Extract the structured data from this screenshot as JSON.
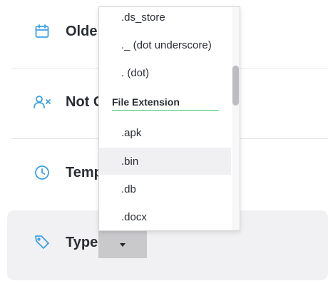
{
  "rows": [
    {
      "label": "Olde",
      "icon": "calendar-icon"
    },
    {
      "label": "Not C",
      "icon": "user-x-icon"
    },
    {
      "label": "Temp",
      "icon": "clock-icon"
    },
    {
      "label": "Type",
      "icon": "tag-icon"
    }
  ],
  "dropdown": {
    "items_before": [
      ".ds_store",
      "._ (dot underscore)",
      ". (dot)"
    ],
    "group_label": "File Extension",
    "items_after": [
      ".apk",
      ".bin",
      ".db",
      ".docx"
    ],
    "hovered_item": ".bin"
  },
  "colors": {
    "icon_blue": "#3aa0e6",
    "group_underline": "#3cc36b",
    "trigger_bg": "#c9c9cc"
  }
}
